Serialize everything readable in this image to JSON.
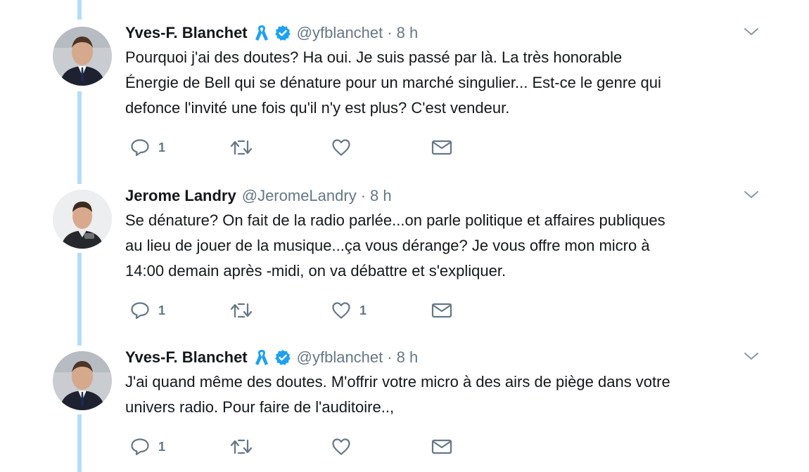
{
  "tweets": [
    {
      "name": "Yves-F. Blanchet",
      "handle": "@yfblanchet",
      "dot": "·",
      "time": "8 h",
      "text": "Pourquoi j'ai des doutes? Ha oui. Je suis passé par là.  La très honorable\nÉnergie de Bell qui se dénature pour un marché singulier... Est-ce le genre qui\ndefonce l'invité une fois qu'il n'y est plus?  C'est vendeur.",
      "reply_count": "1",
      "retweet_count": "",
      "like_count": ""
    },
    {
      "name": "Jerome Landry",
      "handle": "@JeromeLandry",
      "dot": "·",
      "time": "8 h",
      "text": "Se dénature? On fait de la radio parlée...on parle politique et affaires publiques\nau lieu de jouer de la musique...ça vous dérange? Je vous offre mon micro à\n14:00 demain après -midi, on va débattre et s'expliquer.",
      "reply_count": "1",
      "retweet_count": "",
      "like_count": "1"
    },
    {
      "name": "Yves-F. Blanchet",
      "handle": "@yfblanchet",
      "dot": "·",
      "time": "8 h",
      "text": "J'ai quand même des doutes. M'offrir votre micro à des airs de piège dans votre\nunivers radio. Pour faire de l'auditoire..,",
      "reply_count": "1",
      "retweet_count": "",
      "like_count": ""
    }
  ],
  "colors": {
    "thread_line": "#b4ddf7",
    "verified": "#1da1f2",
    "ribbon": "#1da1f2",
    "muted": "#657786",
    "text": "#14171a"
  },
  "icons": [
    "reply-icon",
    "retweet-icon",
    "like-icon",
    "direct-message-icon",
    "caret-down-icon",
    "verified-badge-icon",
    "ribbon-icon"
  ]
}
